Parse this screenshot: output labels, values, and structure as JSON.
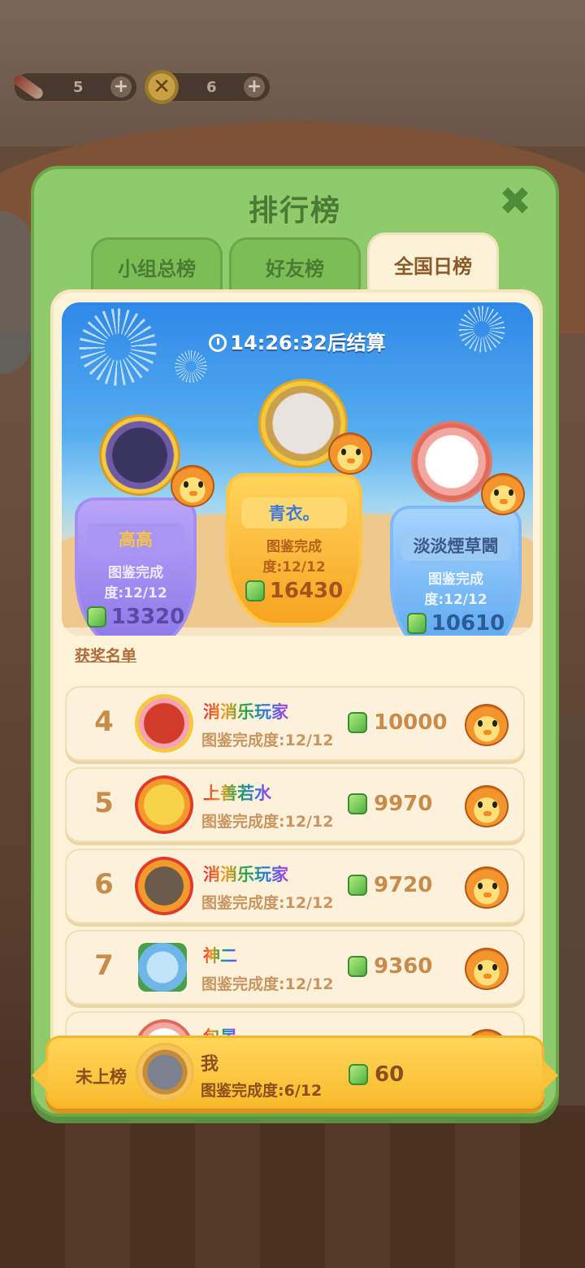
{
  "resources": {
    "rocket_count": "5",
    "coin_count": "6",
    "coin_symbol": "✕"
  },
  "modal": {
    "title": "排行榜",
    "close_icon": "✖"
  },
  "tabs": [
    {
      "label": "小组总榜",
      "active": false
    },
    {
      "label": "好友榜",
      "active": false
    },
    {
      "label": "全国日榜",
      "active": true
    }
  ],
  "timer": {
    "text": "14:26:32后结算"
  },
  "podium": {
    "first": {
      "name": "青衣。",
      "progress": "图鉴完成度:12/12",
      "score": "16430"
    },
    "second": {
      "name": "高高",
      "progress": "图鉴完成度:12/12",
      "score": "13320"
    },
    "third": {
      "name": "淡淡煙草閪",
      "progress": "图鉴完成度:12/12",
      "score": "10610"
    }
  },
  "awards_label": "获奖名单",
  "rows": [
    {
      "rank": "4",
      "name": "消消乐玩家",
      "progress": "图鉴完成度:12/12",
      "score": "10000"
    },
    {
      "rank": "5",
      "name": "上善若水",
      "progress": "图鉴完成度:12/12",
      "score": "9970"
    },
    {
      "rank": "6",
      "name": "消消乐玩家",
      "progress": "图鉴完成度:12/12",
      "score": "9720"
    },
    {
      "rank": "7",
      "name": "神二",
      "progress": "图鉴完成度:12/12",
      "score": "9360"
    },
    {
      "rank": "",
      "name": "包晏",
      "progress": "",
      "score": ""
    }
  ],
  "me": {
    "status": "未上榜",
    "name": "我",
    "progress": "图鉴完成度:6/12",
    "score": "60"
  },
  "colors": {
    "modal_green": "#8fcb6b",
    "panel_cream": "#fdf3d8",
    "gold_accent": "#f9bb2c"
  }
}
